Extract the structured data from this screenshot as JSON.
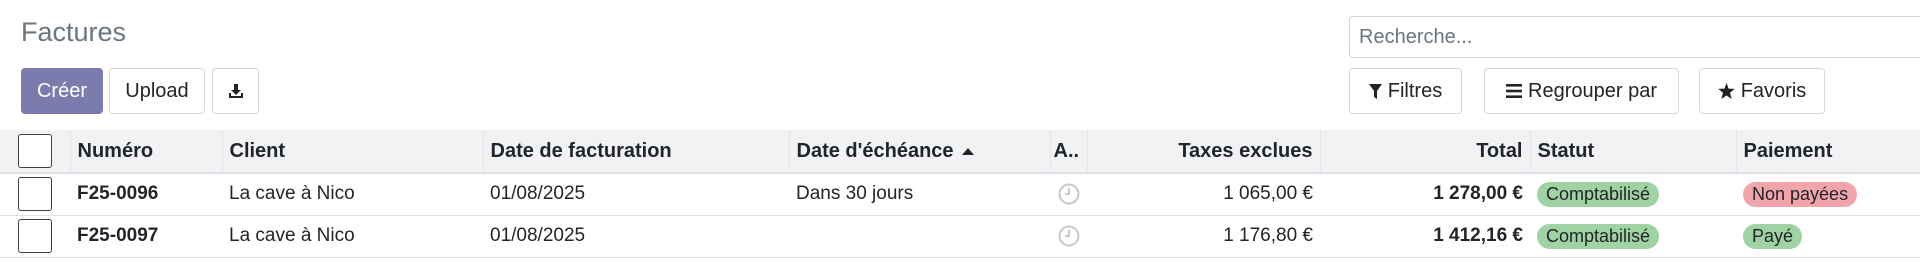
{
  "page": {
    "title": "Factures"
  },
  "toolbar": {
    "create_label": "Créer",
    "upload_label": "Upload",
    "download_icon": "download-icon"
  },
  "search": {
    "placeholder": "Recherche..."
  },
  "filters": {
    "filters_label": "Filtres",
    "group_by_label": "Regrouper par",
    "favorites_label": "Favoris"
  },
  "table": {
    "headers": {
      "number": "Numéro",
      "client": "Client",
      "invoice_date": "Date de facturation",
      "due_date": "Date d'échéance",
      "activity": "A..",
      "untaxed": "Taxes exclues",
      "total": "Total",
      "status": "Statut",
      "payment": "Paiement"
    },
    "sorted_column": "due_date",
    "sort_direction": "ascending",
    "rows": [
      {
        "number": "F25-0096",
        "client": "La cave à Nico",
        "invoice_date": "01/08/2025",
        "due_date": "Dans 30 jours",
        "untaxed": "1 065,00 €",
        "total": "1 278,00 €",
        "status": "Comptabilisé",
        "payment": "Non payées",
        "payment_color": "#f1a4ab"
      },
      {
        "number": "F25-0097",
        "client": "La cave à Nico",
        "invoice_date": "01/08/2025",
        "due_date": "",
        "untaxed": "1 176,80 €",
        "total": "1 412,16 €",
        "status": "Comptabilisé",
        "payment": "Payé",
        "payment_color": "#9fd3a3"
      }
    ]
  },
  "colors": {
    "primary": "#7c7bad",
    "status_posted": "#9fd3a3",
    "not_paid": "#f1a4ab",
    "paid": "#9fd3a3"
  }
}
